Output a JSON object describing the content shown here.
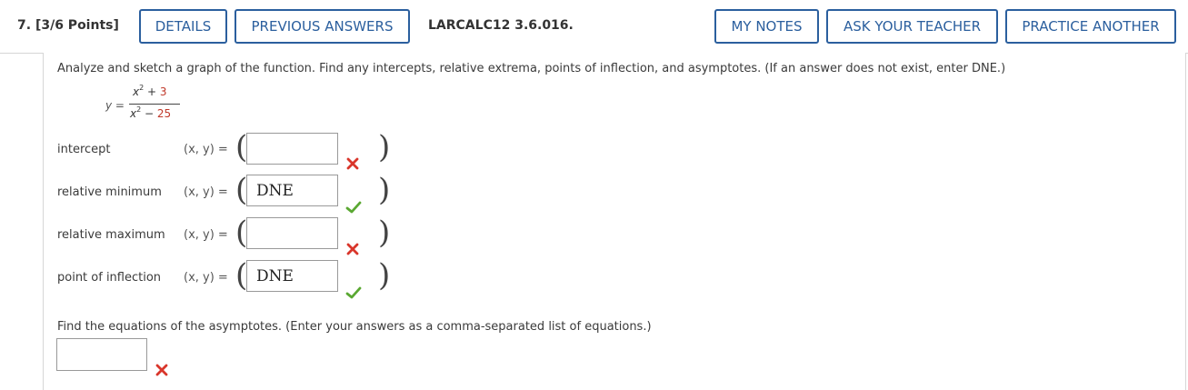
{
  "header": {
    "question_number": "7.",
    "points": "[3/6 Points]",
    "details_label": "DETAILS",
    "previous_answers_label": "PREVIOUS ANSWERS",
    "problem_code": "LARCALC12 3.6.016.",
    "my_notes_label": "MY NOTES",
    "ask_teacher_label": "ASK YOUR TEACHER",
    "practice_another_label": "PRACTICE ANOTHER"
  },
  "problem": {
    "instructions": "Analyze and sketch a graph of the function. Find any intercepts, relative extrema, points of inflection, and asymptotes. (If an answer does not exist, enter DNE.)",
    "function": {
      "lhs": "y =",
      "numerator_base": "x",
      "numerator_exp": "2",
      "numerator_rest": " + ",
      "numerator_const": "3",
      "denominator_base": "x",
      "denominator_exp": "2",
      "denominator_rest": " − ",
      "denominator_const": "25"
    },
    "rows": [
      {
        "label": "intercept",
        "prefix": "(x, y) =",
        "value": "",
        "status": "incorrect"
      },
      {
        "label": "relative minimum",
        "prefix": "(x, y) =",
        "value": "DNE",
        "status": "correct"
      },
      {
        "label": "relative maximum",
        "prefix": "(x, y) =",
        "value": "",
        "status": "incorrect"
      },
      {
        "label": "point of inflection",
        "prefix": "(x, y) =",
        "value": "DNE",
        "status": "correct"
      }
    ],
    "asymptote_instructions": "Find the equations of the asymptotes. (Enter your answers as a comma-separated list of equations.)",
    "asymptote_value": "",
    "asymptote_status": "incorrect"
  },
  "colors": {
    "accent": "#2b5f9e",
    "correct": "#5aa832",
    "incorrect": "#d9362b"
  }
}
